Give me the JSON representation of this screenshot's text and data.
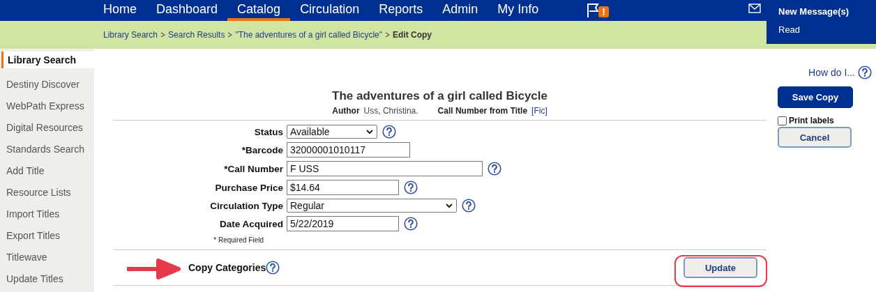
{
  "nav": {
    "items": [
      {
        "label": "Home",
        "selected": false
      },
      {
        "label": "Dashboard",
        "selected": false
      },
      {
        "label": "Catalog",
        "selected": true
      },
      {
        "label": "Circulation",
        "selected": false
      },
      {
        "label": "Reports",
        "selected": false
      },
      {
        "label": "Admin",
        "selected": false
      },
      {
        "label": "My Info",
        "selected": false
      }
    ],
    "alert_badge": "!"
  },
  "messages": {
    "title": "New Message(s)",
    "link": "Read"
  },
  "breadcrumb": {
    "links": [
      "Library Search",
      "Search Results",
      "\"The adventures of a girl called Bicycle\""
    ],
    "current": "Edit Copy"
  },
  "sidebar": {
    "items": [
      {
        "label": "Library Search",
        "selected": true
      },
      {
        "label": "Destiny Discover",
        "selected": false
      },
      {
        "label": "WebPath Express",
        "selected": false
      },
      {
        "label": "Digital Resources",
        "selected": false
      },
      {
        "label": "Standards Search",
        "selected": false
      },
      {
        "label": "Add Title",
        "selected": false
      },
      {
        "label": "Resource Lists",
        "selected": false
      },
      {
        "label": "Import Titles",
        "selected": false
      },
      {
        "label": "Export Titles",
        "selected": false
      },
      {
        "label": "Titlewave",
        "selected": false
      },
      {
        "label": "Update Titles",
        "selected": false
      }
    ]
  },
  "title": "The adventures of a girl called Bicycle",
  "author": {
    "label": "Author",
    "value": "Uss, Christina."
  },
  "call_number_from_title": {
    "label": "Call Number from Title",
    "value": "[Fic]"
  },
  "form": {
    "fields": [
      {
        "kind": "select",
        "label": "Status",
        "value": "Available",
        "help": true
      },
      {
        "kind": "input",
        "label": "*Barcode",
        "value": "32000001010117",
        "help": false
      },
      {
        "kind": "input",
        "label": "*Call Number",
        "value": "F USS",
        "help": true
      },
      {
        "kind": "input",
        "label": "Purchase Price",
        "value": "$14.64",
        "help": true
      },
      {
        "kind": "select",
        "label": "Circulation Type",
        "value": "Regular",
        "help": true
      },
      {
        "kind": "input",
        "label": "Date Acquired",
        "value": "5/22/2019",
        "help": true
      }
    ],
    "required_note": "* Required Field"
  },
  "copy_categories": {
    "label": "Copy Categories",
    "button": "Update"
  },
  "right_panel": {
    "help_link": "How do I...",
    "save_button": "Save Copy",
    "print_labels": {
      "label": "Print labels",
      "checked": false
    },
    "cancel_button": "Cancel"
  }
}
